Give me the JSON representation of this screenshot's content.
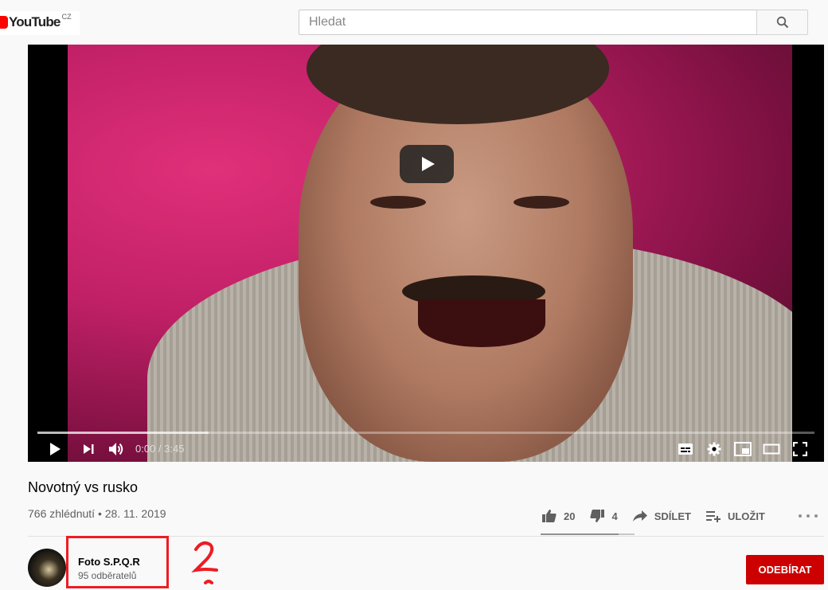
{
  "header": {
    "logo_text": "YouTube",
    "logo_country": "CZ",
    "search_placeholder": "Hledat"
  },
  "player": {
    "time": "0:00 / 3:45",
    "progress_fraction": 0.0
  },
  "video": {
    "title": "Novotný vs rusko",
    "meta": "766 zhlédnutí • 28. 11. 2019",
    "likes": "20",
    "dislikes": "4",
    "share_label": "SDÍLET",
    "save_label": "ULOŽIT",
    "like_fraction": 0.83
  },
  "channel": {
    "name": "Foto S.P.Q.R",
    "subscribers": "95 odběratelů",
    "subscribe_label": "ODEBÍRAT"
  },
  "annotation": {
    "color": "#ee1c24"
  },
  "colors": {
    "brand_red": "#ff0000",
    "subscribe_red": "#cc0000"
  }
}
